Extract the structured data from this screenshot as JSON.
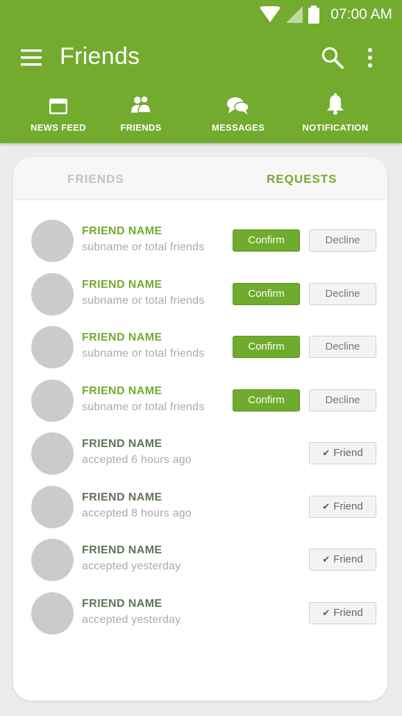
{
  "status": {
    "time": "07:00 AM"
  },
  "toolbar": {
    "title": "Friends",
    "menu_icon": "hamburger-menu-icon",
    "search_icon": "search-icon",
    "more_icon": "more-vertical-icon"
  },
  "nav": {
    "items": [
      {
        "label": "NEWS FEED",
        "icon": "newspaper-icon"
      },
      {
        "label": "FRIENDS",
        "icon": "friends-icon"
      },
      {
        "label": "MESSAGES",
        "icon": "chat-bubbles-icon"
      },
      {
        "label": "NOTIFICATION",
        "icon": "bell-icon"
      }
    ]
  },
  "tabs": {
    "friends": "FRIENDS",
    "requests": "REQUESTS",
    "active": "requests"
  },
  "requests": [
    {
      "name": "FRIEND NAME",
      "sub": "subname or total friends",
      "state": "pending",
      "confirm_label": "Confirm",
      "decline_label": "Decline"
    },
    {
      "name": "FRIEND NAME",
      "sub": "subname or total friends",
      "state": "pending",
      "confirm_label": "Confirm",
      "decline_label": "Decline"
    },
    {
      "name": "FRIEND NAME",
      "sub": "subname or total friends",
      "state": "pending",
      "confirm_label": "Confirm",
      "decline_label": "Decline"
    },
    {
      "name": "FRIEND NAME",
      "sub": "subname or total friends",
      "state": "pending",
      "confirm_label": "Confirm",
      "decline_label": "Decline"
    },
    {
      "name": "FRIEND NAME",
      "sub": "accepted 6 hours ago",
      "state": "accepted",
      "friend_label": "Friend"
    },
    {
      "name": "FRIEND NAME",
      "sub": "accepted 8 hours ago",
      "state": "accepted",
      "friend_label": "Friend"
    },
    {
      "name": "FRIEND NAME",
      "sub": "accepted yesterday",
      "state": "accepted",
      "friend_label": "Friend"
    },
    {
      "name": "FRIEND NAME",
      "sub": "accepted yesterday",
      "state": "accepted",
      "friend_label": "Friend"
    }
  ],
  "colors": {
    "brand": "#72ab2e",
    "accepted_name": "#5e7358",
    "avatar": "#cbcbcb"
  }
}
